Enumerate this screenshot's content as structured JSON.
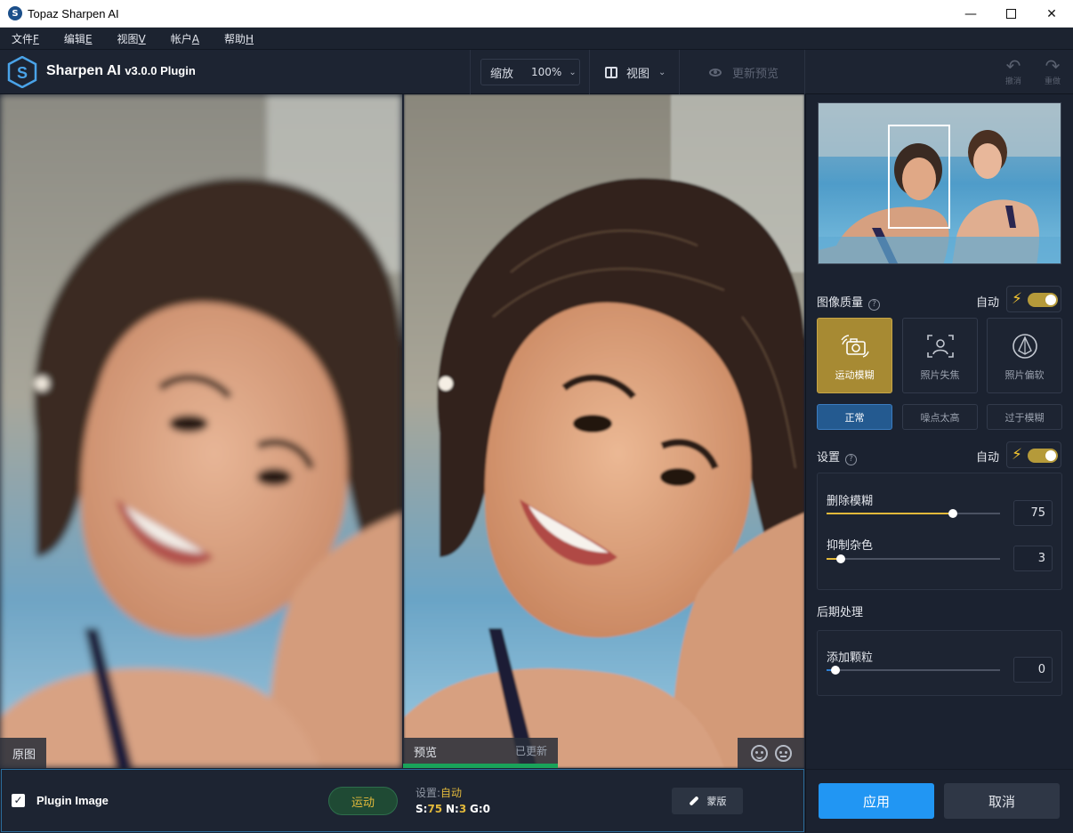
{
  "window": {
    "title": "Topaz Sharpen AI",
    "app_icon_letter": "S"
  },
  "menu": [
    {
      "label": "文件",
      "key": "F"
    },
    {
      "label": "编辑",
      "key": "E"
    },
    {
      "label": "视图",
      "key": "V"
    },
    {
      "label": "帐户",
      "key": "A"
    },
    {
      "label": "帮助",
      "key": "H"
    }
  ],
  "header": {
    "brand": "Sharpen AI",
    "version": "v3.0.0 Plugin",
    "zoom_label": "缩放",
    "zoom_value": "100%",
    "view_label": "视图",
    "refresh_label": "更新预览",
    "undo_label": "撤消",
    "redo_label": "重做"
  },
  "panels": {
    "original_label": "原图",
    "preview_label": "预览",
    "updated_label": "已更新",
    "preview_progress": 1.0
  },
  "bottom": {
    "plugin_image_label": "Plugin Image",
    "plugin_image_checked": true,
    "motion_label": "运动",
    "settings_label": "设置:",
    "settings_mode": "自动",
    "s_label": "S:",
    "s_value": "75",
    "n_label": "N:",
    "n_value": "3",
    "g_label": "G:",
    "g_value": "0",
    "mask_label": "蒙版"
  },
  "right": {
    "quality_title": "图像质量",
    "auto_label": "自动",
    "modes": [
      {
        "label": "运动模糊",
        "icon": "motion-camera-icon",
        "active": true
      },
      {
        "label": "照片失焦",
        "icon": "focus-person-icon",
        "active": false
      },
      {
        "label": "照片偏软",
        "icon": "soft-drop-icon",
        "active": false
      }
    ],
    "subs": [
      {
        "label": "正常",
        "active": true
      },
      {
        "label": "噪点太高",
        "active": false
      },
      {
        "label": "过于模糊",
        "active": false
      }
    ],
    "settings_title": "设置",
    "settings_auto_label": "自动",
    "remove_blur_label": "删除模糊",
    "remove_blur_value": "75",
    "remove_blur_fraction": 0.73,
    "suppress_noise_label": "抑制杂色",
    "suppress_noise_value": "3",
    "suppress_noise_fraction": 0.08,
    "post_title": "后期处理",
    "grain_label": "添加颗粒",
    "grain_value": "0",
    "grain_fraction": 0.05,
    "apply_label": "应用",
    "cancel_label": "取消"
  },
  "colors": {
    "accent_gold": "#e2b93b",
    "apply_blue": "#2196f3",
    "progress_green": "#19a35a",
    "blur_slider": "#e2b93b",
    "grain_slider": "#2d7fd3"
  }
}
